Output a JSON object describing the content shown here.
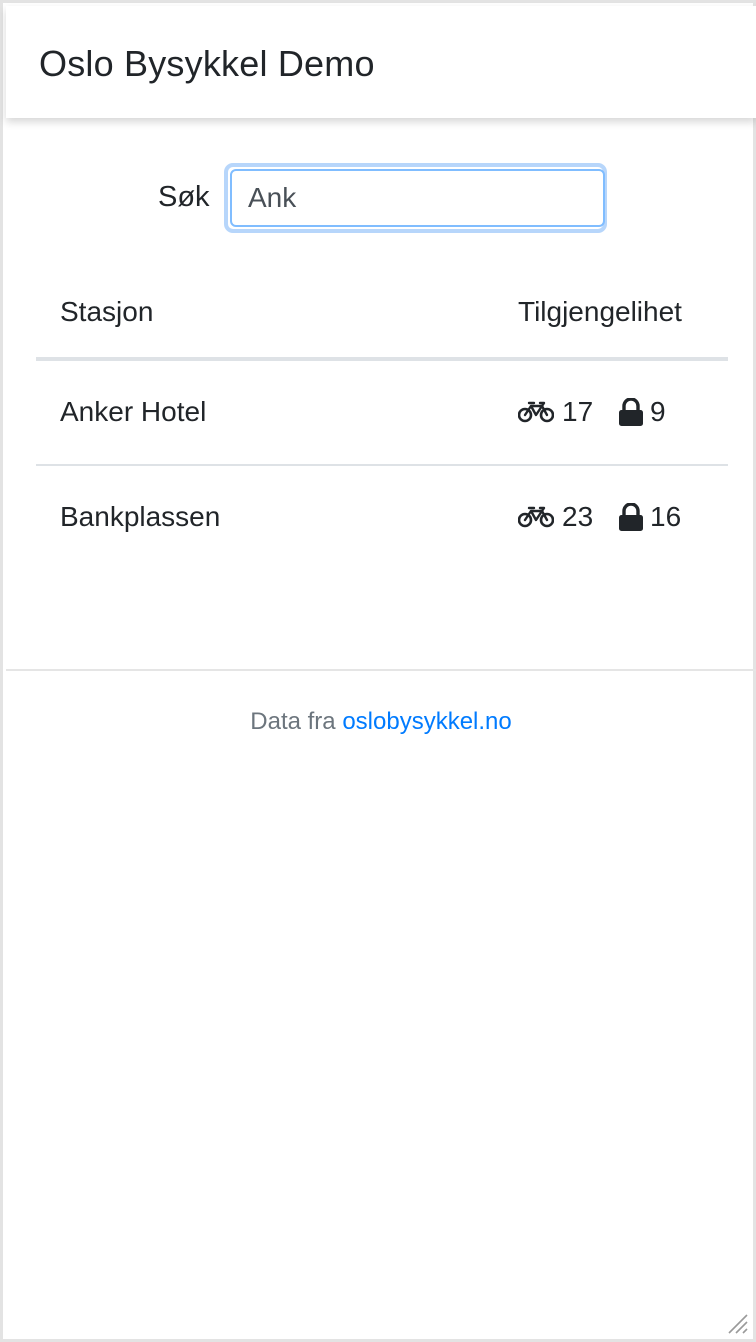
{
  "header": {
    "title": "Oslo Bysykkel Demo"
  },
  "search": {
    "label": "Søk",
    "value": "Ank",
    "placeholder": ""
  },
  "table": {
    "columns": [
      "Stasjon",
      "Tilgjengelihet"
    ],
    "rows": [
      {
        "station": "Anker Hotel",
        "bikes": "17",
        "docks": "9"
      },
      {
        "station": "Bankplassen",
        "bikes": "23",
        "docks": "16"
      }
    ]
  },
  "footer": {
    "prefix": "Data fra",
    "link_text": "oslobysykkel.no"
  },
  "icons": {
    "bike": "bicycle-icon",
    "dock": "lock-icon",
    "grip": "resize-grip-icon"
  },
  "colors": {
    "link": "#007bff",
    "focus_ring": "#b7d6fb",
    "text": "#212529",
    "muted": "#6c757d"
  }
}
